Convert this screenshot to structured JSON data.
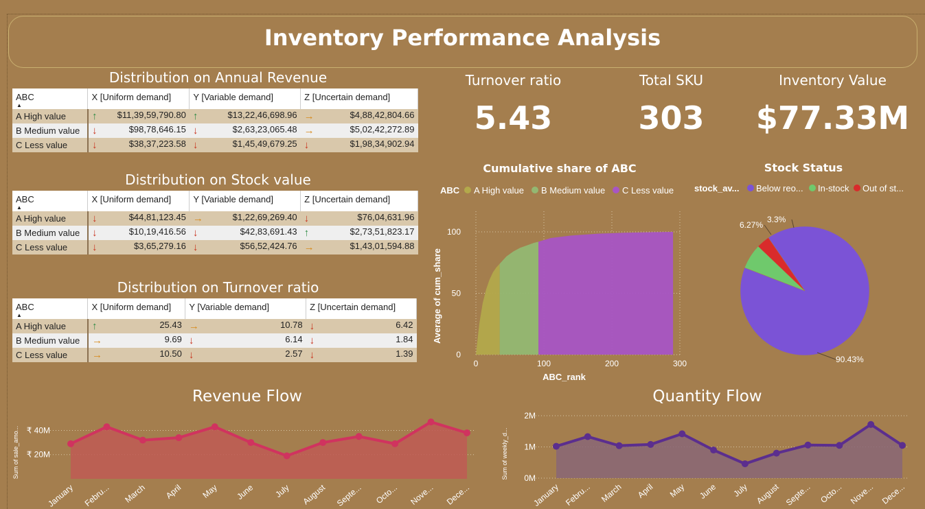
{
  "page_title": "Inventory Performance Analysis",
  "tables": [
    {
      "title": "Distribution on Annual Revenue",
      "headers": [
        "ABC",
        "X [Uniform demand]",
        "Y [Variable demand]",
        "Z [Uncertain demand]"
      ],
      "rows": [
        {
          "label": "A High value",
          "cells": [
            {
              "icon": "up",
              "value": "$11,39,59,790.80"
            },
            {
              "icon": "up",
              "value": "$13,22,46,698.96"
            },
            {
              "icon": "side",
              "value": "$4,88,42,804.66"
            }
          ]
        },
        {
          "label": "B Medium value",
          "cells": [
            {
              "icon": "down",
              "value": "$98,78,646.15"
            },
            {
              "icon": "down",
              "value": "$2,63,23,065.48"
            },
            {
              "icon": "side",
              "value": "$5,02,42,272.89"
            }
          ]
        },
        {
          "label": "C Less value",
          "cells": [
            {
              "icon": "down",
              "value": "$38,37,223.58"
            },
            {
              "icon": "down",
              "value": "$1,45,49,679.25"
            },
            {
              "icon": "down",
              "value": "$1,98,34,902.94"
            }
          ]
        }
      ]
    },
    {
      "title": "Distribution on Stock value",
      "headers": [
        "ABC",
        "X [Uniform demand]",
        "Y [Variable demand]",
        "Z [Uncertain demand]"
      ],
      "rows": [
        {
          "label": "A High value",
          "cells": [
            {
              "icon": "down",
              "value": "$44,81,123.45"
            },
            {
              "icon": "side",
              "value": "$1,22,69,269.40"
            },
            {
              "icon": "down",
              "value": "$76,04,631.96"
            }
          ]
        },
        {
          "label": "B Medium value",
          "cells": [
            {
              "icon": "down",
              "value": "$10,19,416.56"
            },
            {
              "icon": "down",
              "value": "$42,83,691.43"
            },
            {
              "icon": "up",
              "value": "$2,73,51,823.17"
            }
          ]
        },
        {
          "label": "C Less value",
          "cells": [
            {
              "icon": "down",
              "value": "$3,65,279.16"
            },
            {
              "icon": "down",
              "value": "$56,52,424.76"
            },
            {
              "icon": "side",
              "value": "$1,43,01,594.88"
            }
          ]
        }
      ]
    },
    {
      "title": "Distribution on Turnover ratio",
      "headers": [
        "ABC",
        "X [Uniform demand]",
        "Y [Variable demand]",
        "Z [Uncertain demand]"
      ],
      "rows": [
        {
          "label": "A High value",
          "cells": [
            {
              "icon": "up",
              "value": "25.43"
            },
            {
              "icon": "side",
              "value": "10.78"
            },
            {
              "icon": "down",
              "value": "6.42"
            }
          ]
        },
        {
          "label": "B Medium value",
          "cells": [
            {
              "icon": "side",
              "value": "9.69"
            },
            {
              "icon": "down",
              "value": "6.14"
            },
            {
              "icon": "down",
              "value": "1.84"
            }
          ]
        },
        {
          "label": "C Less value",
          "cells": [
            {
              "icon": "side",
              "value": "10.50"
            },
            {
              "icon": "down",
              "value": "2.57"
            },
            {
              "icon": "down",
              "value": "1.39"
            }
          ]
        }
      ]
    }
  ],
  "icon_glyphs": {
    "up": "🡑",
    "down": "🡓",
    "side": "🡒"
  },
  "kpis": [
    {
      "label": "Turnover ratio",
      "value": "5.43"
    },
    {
      "label": "Total SKU",
      "value": "303"
    },
    {
      "label": "Inventory Value",
      "value": "$77.33M"
    }
  ],
  "colors": {
    "background": "#a47e4e",
    "abc_a": "#b3a94b",
    "abc_b": "#93b872",
    "abc_c": "#a855c4",
    "pie_below": "#7b53d6",
    "pie_instock": "#6fc96c",
    "pie_out": "#d92b2b",
    "revenue": "#d0335f",
    "revenue_fill": "#bf5a55",
    "quantity": "#5b2e8e",
    "quantity_fill": "#8a6677"
  },
  "chart_data": [
    {
      "type": "area",
      "title": "Cumulative share of ABC",
      "legend_title": "ABC",
      "xlabel": "ABC_rank",
      "ylabel": "Average of cum_share",
      "xlim": [
        0,
        300
      ],
      "ylim": [
        0,
        100
      ],
      "xticks": [
        "0",
        "100",
        "200",
        "300"
      ],
      "yticks": [
        "0",
        "50",
        "100"
      ],
      "series": [
        {
          "name": "A High value",
          "x": [
            0,
            5,
            10,
            15,
            20,
            25,
            30,
            35
          ],
          "y": [
            0,
            25,
            42,
            53,
            61,
            67,
            71,
            74
          ]
        },
        {
          "name": "B Medium value",
          "x": [
            35,
            45,
            55,
            65,
            75,
            85,
            92
          ],
          "y": [
            74,
            80,
            84,
            87,
            89,
            91,
            92
          ]
        },
        {
          "name": "C Less value",
          "x": [
            92,
            110,
            140,
            180,
            220,
            260,
            290
          ],
          "y": [
            92,
            95,
            97,
            98.5,
            99.3,
            99.8,
            100
          ]
        }
      ]
    },
    {
      "type": "pie",
      "title": "Stock Status",
      "legend_title": "stock_av...",
      "categories": [
        "Below reo...",
        "In-stock",
        "Out of st..."
      ],
      "values": [
        90.43,
        6.27,
        3.3
      ],
      "labels": [
        "90.43%",
        "6.27%",
        "3.3%"
      ]
    },
    {
      "type": "area",
      "title": "Revenue Flow",
      "ylabel": "Sum of sale_amo...",
      "categories": [
        "January",
        "Febru...",
        "March",
        "April",
        "May",
        "June",
        "July",
        "August",
        "Septe...",
        "Octo...",
        "Nove...",
        "Dece..."
      ],
      "values": [
        29,
        43,
        32,
        34,
        43,
        30,
        19,
        30,
        35,
        29,
        47,
        38
      ],
      "ylim": [
        0,
        55
      ],
      "yticks": [
        {
          "label": "₹ 20M",
          "v": 20
        },
        {
          "label": "₹ 40M",
          "v": 40
        }
      ]
    },
    {
      "type": "area",
      "title": "Quantity Flow",
      "ylabel": "Sum of weekly_d...",
      "categories": [
        "January",
        "Febru...",
        "March",
        "April",
        "May",
        "June",
        "July",
        "August",
        "Septe...",
        "Octo...",
        "Nove...",
        "Dece..."
      ],
      "values": [
        1.02,
        1.33,
        1.04,
        1.08,
        1.42,
        0.9,
        0.46,
        0.8,
        1.06,
        1.05,
        1.72,
        1.05
      ],
      "ylim": [
        0,
        2
      ],
      "yticks": [
        {
          "label": "0M",
          "v": 0
        },
        {
          "label": "1M",
          "v": 1
        },
        {
          "label": "2M",
          "v": 2
        }
      ]
    }
  ]
}
